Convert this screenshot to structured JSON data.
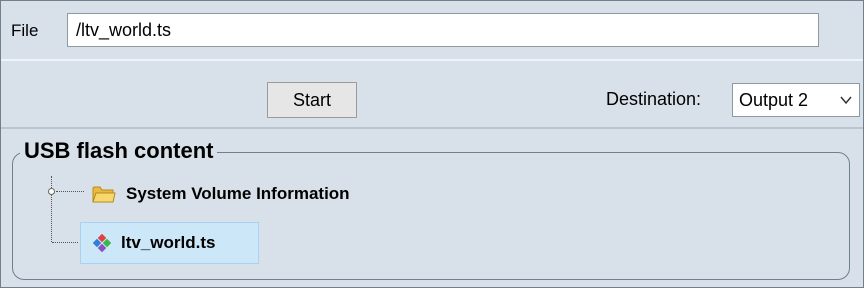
{
  "file": {
    "label": "File",
    "value": "/ltv_world.ts"
  },
  "actions": {
    "start_label": "Start",
    "destination_label": "Destination:",
    "destination_selected": "Output 2"
  },
  "usb": {
    "legend": "USB flash content",
    "items": [
      {
        "label": "System Volume Information",
        "icon": "folder-icon"
      },
      {
        "label": "ltv_world.ts",
        "icon": "ts-file-icon",
        "selected": true
      }
    ]
  },
  "colors": {
    "panel_bg": "#d8e1ea",
    "selection_bg": "#cce7f8",
    "folder_yellow": "#f3c94f"
  }
}
